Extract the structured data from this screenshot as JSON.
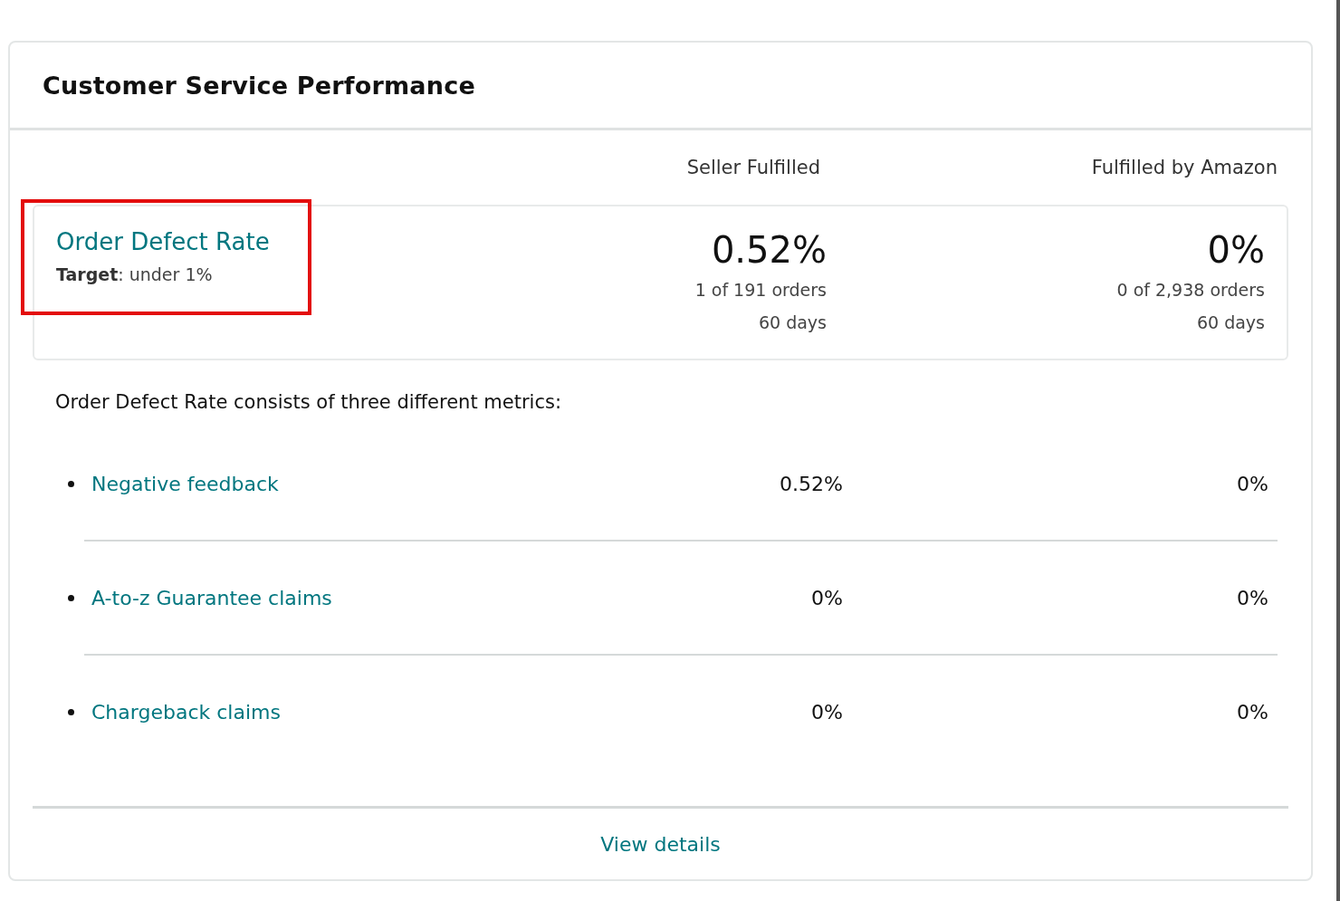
{
  "card": {
    "title": "Customer Service Performance",
    "columns": [
      "Seller Fulfilled",
      "Fulfilled by Amazon"
    ],
    "summary": {
      "name": "Order Defect Rate",
      "target_label": "Target",
      "target_value": ": under 1%",
      "highlighted": true,
      "values": [
        {
          "rate": "0.52%",
          "orders": "1 of 191 orders",
          "period": "60 days"
        },
        {
          "rate": "0%",
          "orders": "0 of 2,938 orders",
          "period": "60 days"
        }
      ]
    },
    "description": "Order Defect Rate consists of three different metrics:",
    "metrics": [
      {
        "name": "Negative feedback",
        "values": [
          "0.52%",
          "0%"
        ]
      },
      {
        "name": "A-to-z Guarantee claims",
        "values": [
          "0%",
          "0%"
        ]
      },
      {
        "name": "Chargeback claims",
        "values": [
          "0%",
          "0%"
        ]
      }
    ],
    "footer_link": "View details"
  }
}
